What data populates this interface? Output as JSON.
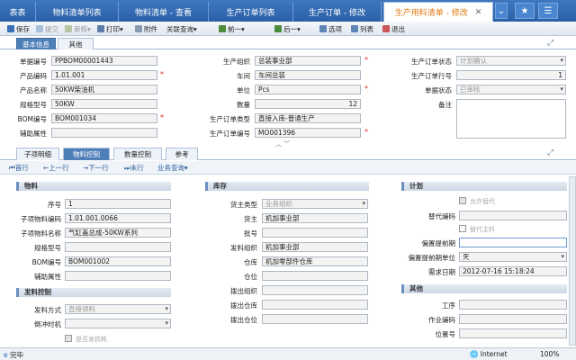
{
  "tabs": [
    {
      "label": "表表",
      "active": false
    },
    {
      "label": "物料清单列表",
      "active": false
    },
    {
      "label": "物料清单 - 查看",
      "active": false
    },
    {
      "label": "生产订单列表",
      "active": false
    },
    {
      "label": "生产订单 - 修改",
      "active": false
    },
    {
      "label": "生产用料清单 - 修改",
      "active": true
    }
  ],
  "toolbar": {
    "save": "保存",
    "submit": "提交",
    "audit": "审核",
    "print": "打印",
    "attach": "附件",
    "related": "关联查询",
    "prev": "前一",
    "next": "后一",
    "options": "选项",
    "list": "列表",
    "exit": "退出"
  },
  "form_tabs": {
    "basic": "基本信息",
    "other": "其他"
  },
  "basic": {
    "code_label": "单据编号",
    "code": "PPBOM00001443",
    "product_code_label": "产品编码",
    "product_code": "1.01.001",
    "product_name_label": "产品名称",
    "product_name": "50KW柴油机",
    "spec_label": "规格型号",
    "spec": "50KW",
    "bom_label": "BOM编号",
    "bom": "BOM001034",
    "aux_label": "辅助属性",
    "aux": "",
    "org_label": "生产组织",
    "org": "总装事业部",
    "workshop_label": "车间",
    "workshop": "车间总装",
    "unit_label": "单位",
    "unit": "Pcs",
    "qty_label": "数量",
    "qty": "12",
    "order_type_label": "生产订单类型",
    "order_type": "直接入库-普通生产",
    "order_no_label": "生产订单编号",
    "order_no": "MO001396",
    "order_status_label": "生产订单状态",
    "order_status": "计划确认",
    "order_line_label": "生产订单行号",
    "order_line": "1",
    "doc_status_label": "单据状态",
    "doc_status": "已审核",
    "remark_label": "备注",
    "remark": ""
  },
  "sub_tabs": {
    "detail": "子项明细",
    "material": "物料控制",
    "qty": "数量控制",
    "ref": "参考"
  },
  "nav": {
    "first": "首行",
    "prev": "上一行",
    "next": "下一行",
    "last": "末行",
    "query": "业务查询"
  },
  "material": {
    "title": "物料",
    "seq_label": "序号",
    "seq": "1",
    "item_code_label": "子项物料编码",
    "item_code": "1.01.001.0066",
    "item_name_label": "子项物料名称",
    "item_name": "气缸盖总成-50KW系列",
    "item_spec_label": "规格型号",
    "item_spec": "",
    "item_bom_label": "BOM编号",
    "item_bom": "BOM001002",
    "item_aux_label": "辅助属性",
    "item_aux": ""
  },
  "issue": {
    "title": "发料控制",
    "method_label": "发料方式",
    "method": "直接领料",
    "backflush_label": "倒冲时机",
    "backflush": "",
    "check_label": "是否发损耗"
  },
  "stock": {
    "title": "库存",
    "owner_type_label": "货主类型",
    "owner_type": "业务组织",
    "owner_label": "货主",
    "owner": "机加事业部",
    "lot_label": "批号",
    "lot": "",
    "issue_org_label": "发料组织",
    "issue_org": "机加事业部",
    "warehouse_label": "仓库",
    "warehouse": "机加零部件仓库",
    "location_label": "仓位",
    "location": "",
    "pick_org_label": "拨出组织",
    "pick_org": "",
    "pick_wh_label": "拨出仓库",
    "pick_wh": "",
    "pick_loc_label": "拨出仓位",
    "pick_loc": ""
  },
  "plan": {
    "title": "计划",
    "allow_sub_label": "允许替代",
    "sub_code_label": "替代编码",
    "sub_code": "",
    "sub_main_label": "替代主料",
    "offset_label": "偏置提前期",
    "offset": "",
    "offset_unit_label": "偏置提前期单位",
    "offset_unit": "天",
    "need_date_label": "需求日期",
    "need_date": "2012-07-16 15:18:24"
  },
  "other": {
    "title": "其他",
    "process_label": "工序",
    "process": "",
    "op_label": "作业编码",
    "op": "",
    "pos_label": "位置号",
    "pos": ""
  },
  "status": {
    "done": "完毕",
    "zone": "Internet",
    "zoom": "100%"
  }
}
